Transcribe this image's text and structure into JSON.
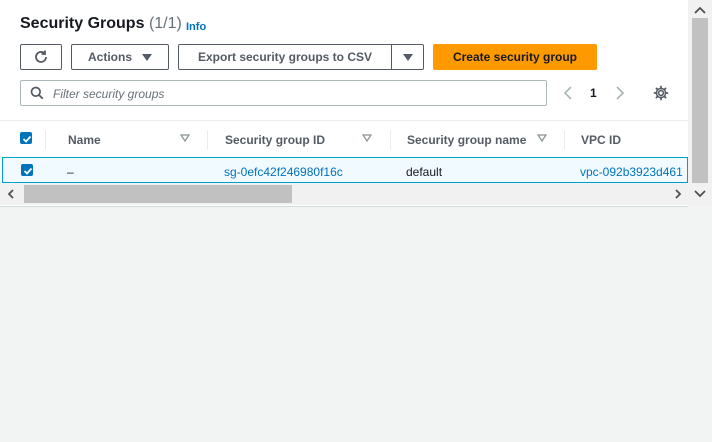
{
  "header": {
    "title": "Security Groups",
    "count": "(1/1)",
    "info_label": "Info"
  },
  "toolbar": {
    "actions_label": "Actions",
    "export_label": "Export security groups to CSV",
    "create_label": "Create security group"
  },
  "search": {
    "placeholder": "Filter security groups",
    "value": ""
  },
  "pagination": {
    "current_page": "1"
  },
  "table": {
    "columns": [
      "Name",
      "Security group ID",
      "Security group name",
      "VPC ID"
    ],
    "rows": [
      {
        "selected": true,
        "name": "–",
        "security_group_id": "sg-0efc42f246980f16c",
        "security_group_name": "default",
        "vpc_id": "vpc-092b3923d461"
      }
    ]
  },
  "colors": {
    "primary_button": "#ff9900",
    "link": "#0073bb",
    "selected_row_bg": "#f1faff",
    "selected_row_border": "#00a1c9"
  }
}
